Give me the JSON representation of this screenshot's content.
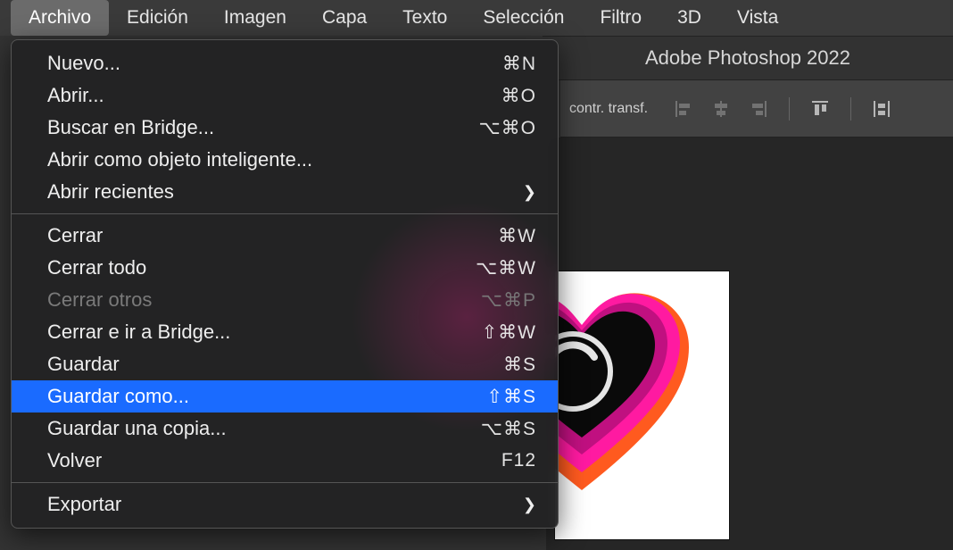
{
  "app_title": "Adobe Photoshop 2022",
  "menubar": [
    "Archivo",
    "Edición",
    "Imagen",
    "Capa",
    "Texto",
    "Selección",
    "Filtro",
    "3D",
    "Vista"
  ],
  "active_menu_index": 0,
  "toolbar_label": "contr. transf.",
  "dropdown": {
    "groups": [
      [
        {
          "label": "Nuevo...",
          "shortcut": "⌘N"
        },
        {
          "label": "Abrir...",
          "shortcut": "⌘O"
        },
        {
          "label": "Buscar en Bridge...",
          "shortcut": "⌥⌘O"
        },
        {
          "label": "Abrir como objeto inteligente...",
          "shortcut": ""
        },
        {
          "label": "Abrir recientes",
          "shortcut": "",
          "submenu": true
        }
      ],
      [
        {
          "label": "Cerrar",
          "shortcut": "⌘W"
        },
        {
          "label": "Cerrar todo",
          "shortcut": "⌥⌘W"
        },
        {
          "label": "Cerrar otros",
          "shortcut": "⌥⌘P",
          "disabled": true
        },
        {
          "label": "Cerrar e ir a Bridge...",
          "shortcut": "⇧⌘W"
        },
        {
          "label": "Guardar",
          "shortcut": "⌘S"
        },
        {
          "label": "Guardar como...",
          "shortcut": "⇧⌘S",
          "highlight": true
        },
        {
          "label": "Guardar una copia...",
          "shortcut": "⌥⌘S"
        },
        {
          "label": "Volver",
          "shortcut": "F12"
        }
      ],
      [
        {
          "label": "Exportar",
          "shortcut": "",
          "submenu": true
        }
      ]
    ]
  }
}
